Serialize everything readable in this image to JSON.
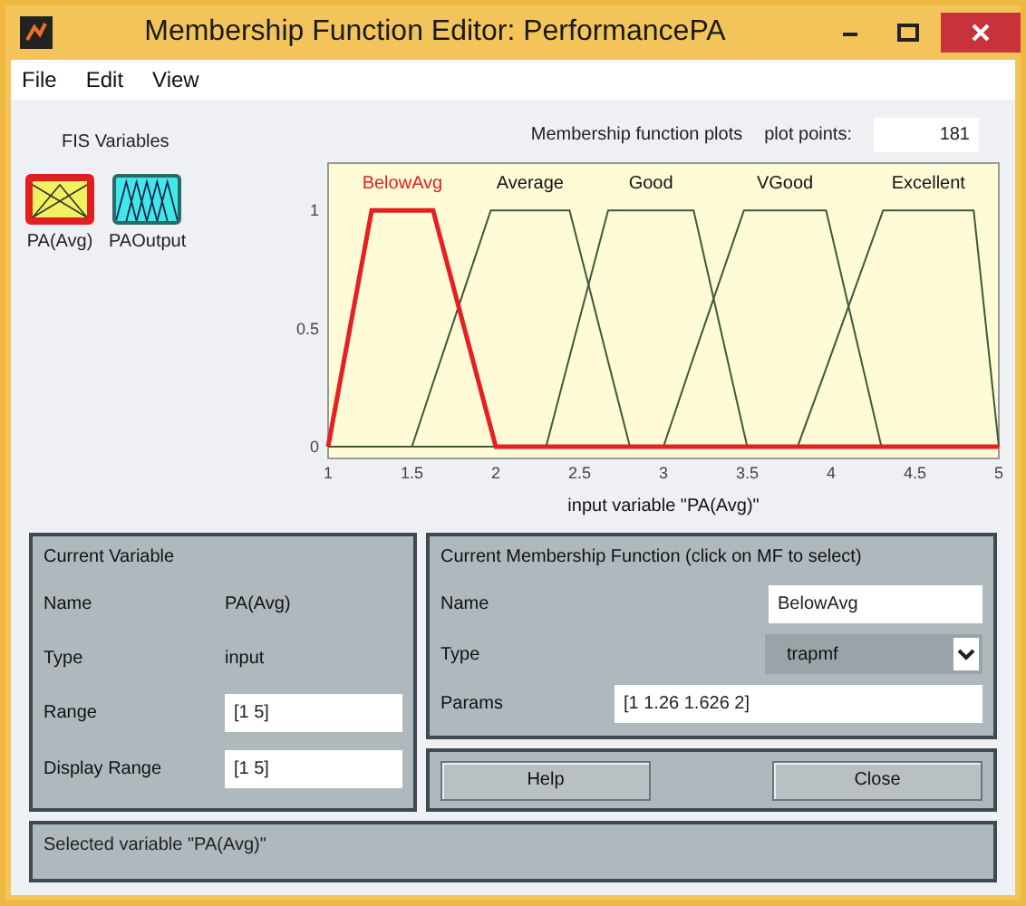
{
  "window": {
    "title": "Membership Function Editor: PerformancePA"
  },
  "menu": [
    "File",
    "Edit",
    "View"
  ],
  "fis_variables": {
    "title": "FIS Variables",
    "items": [
      {
        "label": "PA(Avg)",
        "kind": "input",
        "selected": true
      },
      {
        "label": "PAOutput",
        "kind": "output",
        "selected": false
      }
    ]
  },
  "plot": {
    "title": "Membership function plots",
    "points_label": "plot points:",
    "points_value": "181",
    "chart_data": {
      "type": "line",
      "xlabel": "input variable \"PA(Avg)\"",
      "x": [
        1,
        1.26,
        1.5,
        1.626,
        1.97,
        2,
        2.3,
        2.44,
        2.67,
        2.8,
        3,
        3.18,
        3.48,
        3.5,
        3.8,
        3.97,
        4.3,
        4.31,
        4.85,
        5
      ],
      "series": [
        {
          "name": "Average",
          "color": "#3c5a3c",
          "values": [
            0,
            0,
            0,
            0.27,
            1,
            1,
            1,
            1,
            0.36,
            0,
            0,
            0,
            0,
            0,
            0,
            0,
            0,
            0,
            0,
            0
          ]
        },
        {
          "name": "Good",
          "color": "#3c5a3c",
          "values": [
            0,
            0,
            0,
            0,
            0,
            0,
            0,
            0.38,
            1,
            1,
            1,
            1,
            0.06,
            0,
            0,
            0,
            0,
            0,
            0,
            0
          ]
        },
        {
          "name": "VGood",
          "color": "#3c5a3c",
          "values": [
            0,
            0,
            0,
            0,
            0,
            0,
            0,
            0,
            0,
            0,
            0,
            0.38,
            1,
            1,
            1,
            1,
            0,
            0,
            0,
            0
          ]
        },
        {
          "name": "Excellent",
          "color": "#3c5a3c",
          "values": [
            0,
            0,
            0,
            0,
            0,
            0,
            0,
            0,
            0,
            0,
            0,
            0,
            0,
            0,
            0,
            0.33,
            0.98,
            1,
            1,
            0
          ]
        },
        {
          "name": "BelowAvg",
          "color": "#e42020",
          "values": [
            0,
            1,
            1,
            1,
            0.08,
            0,
            0,
            0,
            0,
            0,
            0,
            0,
            0,
            0,
            0,
            0,
            0,
            0,
            0,
            0
          ]
        }
      ],
      "xlim": [
        1,
        5
      ],
      "ylim": [
        -0.05,
        1.2
      ],
      "xticks": [
        1,
        1.5,
        2,
        2.5,
        3,
        3.5,
        4,
        4.5,
        5
      ],
      "yticks": [
        0,
        0.5,
        1
      ]
    },
    "curves": [
      {
        "selected": false
      },
      {
        "selected": false
      },
      {
        "selected": false
      },
      {
        "selected": false
      },
      {
        "selected": true
      }
    ]
  },
  "current_variable": {
    "title": "Current Variable",
    "rows": [
      {
        "label": "Name",
        "value": "PA(Avg)",
        "kind": "text"
      },
      {
        "label": "Type",
        "value": "input",
        "kind": "text"
      },
      {
        "label": "Range",
        "value": "[1 5]",
        "kind": "field"
      },
      {
        "label": "Display Range",
        "value": "[1 5]",
        "kind": "field"
      }
    ]
  },
  "current_mf": {
    "title": "Current Membership Function (click on MF to select)",
    "rows": [
      {
        "label": "Name",
        "value": "BelowAvg",
        "kind": "field"
      },
      {
        "label": "Type",
        "value": "trapmf",
        "kind": "select"
      },
      {
        "label": "Params",
        "value": "[1 1.26 1.626 2]",
        "kind": "wide"
      }
    ]
  },
  "buttons": [
    "Help",
    "Close"
  ],
  "status": "Selected variable \"PA(Avg)\""
}
